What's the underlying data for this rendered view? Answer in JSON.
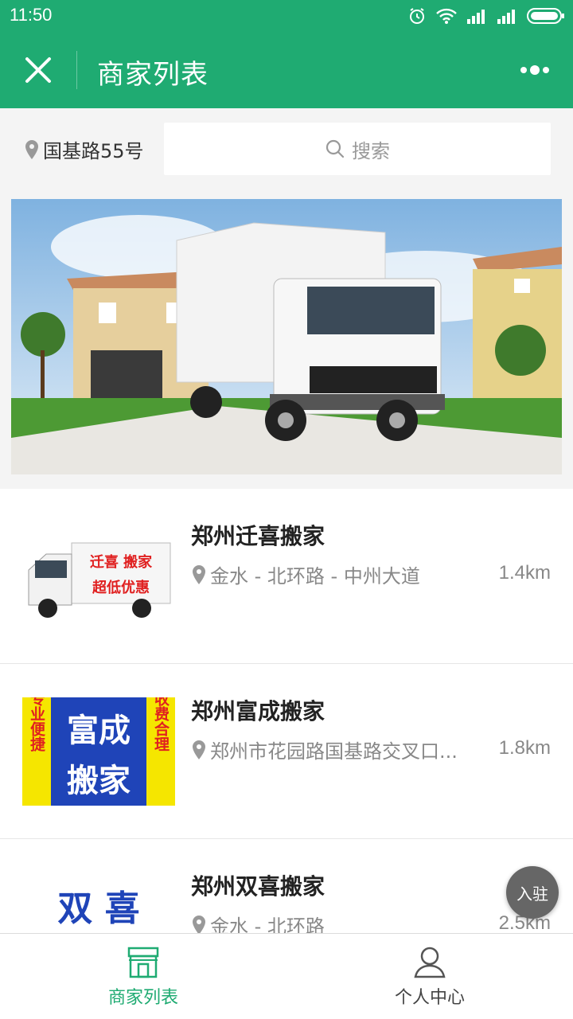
{
  "status_bar": {
    "time": "11:50"
  },
  "nav": {
    "title": "商家列表"
  },
  "location": {
    "text": "国基路55号"
  },
  "search": {
    "placeholder": "搜索"
  },
  "merchants": [
    {
      "name": "郑州迁喜搬家",
      "address": "金水 - 北环路 - 中州大道",
      "distance": "1.4km",
      "thumb_text": [
        "迁喜 搬家",
        "超低优惠"
      ]
    },
    {
      "name": "郑州富成搬家",
      "address": "郑州市花园路国基路交叉口...",
      "distance": "1.8km",
      "thumb_text": [
        "富成",
        "搬家",
        "专业便捷",
        "收费合理"
      ]
    },
    {
      "name": "郑州双喜搬家",
      "address": "金水 - 北环路",
      "distance": "2.5km",
      "thumb_text": [
        "双 喜"
      ]
    }
  ],
  "fab": {
    "label": "入驻"
  },
  "tabs": [
    {
      "label": "商家列表",
      "icon": "store-icon",
      "active": true
    },
    {
      "label": "个人中心",
      "icon": "person-icon",
      "active": false
    }
  ],
  "colors": {
    "primary": "#1fab72",
    "text": "#222222",
    "muted": "#888888"
  }
}
